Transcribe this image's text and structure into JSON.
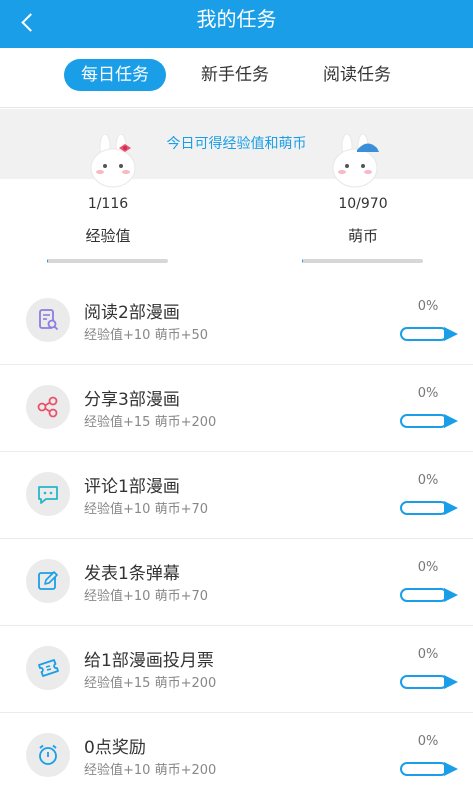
{
  "header": {
    "title": "我的任务",
    "back_icon": "chevron-left-icon"
  },
  "tabs": [
    {
      "label": "每日任务",
      "active": true
    },
    {
      "label": "新手任务",
      "active": false
    },
    {
      "label": "阅读任务",
      "active": false
    }
  ],
  "summary": {
    "note": "今日可得经验值和萌币",
    "experience": {
      "value": "1/116",
      "label": "经验值",
      "progress": 0.009
    },
    "coins": {
      "value": "10/970",
      "label": "萌币",
      "progress": 0.01
    }
  },
  "tasks": [
    {
      "icon": "document-search-icon",
      "title": "阅读2部漫画",
      "reward": "经验值+10 萌币+50",
      "percent": "0%",
      "progress": 0
    },
    {
      "icon": "share-icon",
      "title": "分享3部漫画",
      "reward": "经验值+15 萌币+200",
      "percent": "0%",
      "progress": 0
    },
    {
      "icon": "comment-icon",
      "title": "评论1部漫画",
      "reward": "经验值+10 萌币+70",
      "percent": "0%",
      "progress": 0
    },
    {
      "icon": "edit-icon",
      "title": "发表1条弹幕",
      "reward": "经验值+10 萌币+70",
      "percent": "0%",
      "progress": 0
    },
    {
      "icon": "ticket-icon",
      "title": "给1部漫画投月票",
      "reward": "经验值+15 萌币+200",
      "percent": "0%",
      "progress": 0
    },
    {
      "icon": "alarm-clock-icon",
      "title": "0点奖励",
      "reward": "经验值+10 萌币+200",
      "percent": "0%",
      "progress": 0
    }
  ],
  "colors": {
    "accent": "#1a9ee8",
    "background": "#f1f1f1",
    "icon_share": "#e8536b",
    "icon_document": "#8a7de0",
    "icon_comment": "#26b7c9",
    "icon_edit": "#1a9ee8",
    "icon_ticket": "#1a9ee8",
    "icon_alarm": "#1a9ee8"
  }
}
